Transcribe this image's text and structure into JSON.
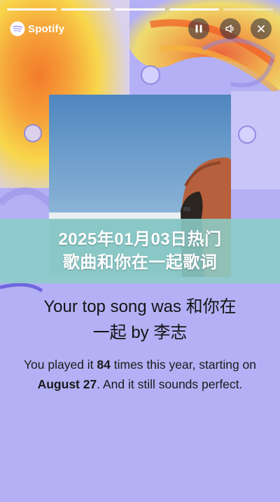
{
  "app": {
    "brand": "Spotify"
  },
  "progress": {
    "segments_total": 5,
    "segments_done": 4
  },
  "controls": {
    "pause_icon": "pause-icon",
    "sound_icon": "sound-icon",
    "close_icon": "close-icon"
  },
  "banner": {
    "line1": "2025年01月03日热门",
    "line2": "歌曲和你在一起歌词"
  },
  "headline": {
    "line1": "Your top song was 和你在",
    "line2": "一起 by 李志"
  },
  "stats": {
    "prefix": "You played it ",
    "count": "84",
    "mid": " times this year, starting on ",
    "date": "August 27",
    "suffix": ". And it still sounds perfect."
  },
  "colors": {
    "background": "#b3b0f5",
    "banner": "#8ccdc8",
    "accent_orange": "#f6a33a"
  }
}
